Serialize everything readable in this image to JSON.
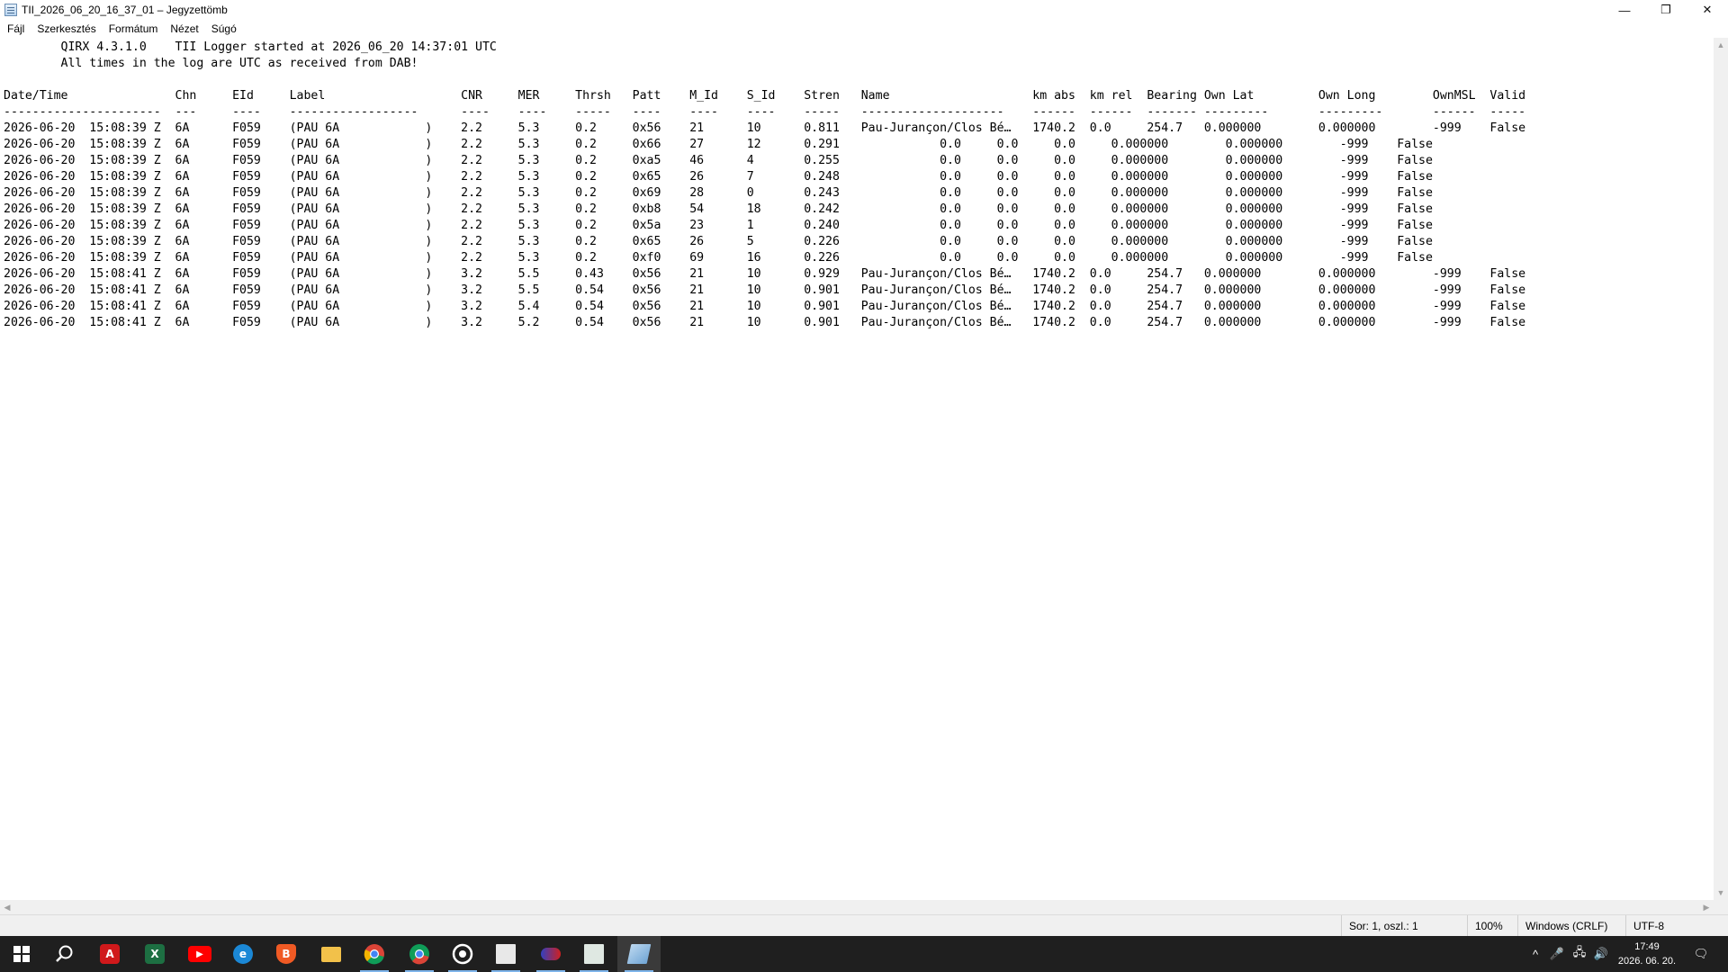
{
  "window": {
    "title": "TII_2026_06_20_16_37_01 – Jegyzettömb",
    "minimize": "—",
    "restore": "❐",
    "close": "✕"
  },
  "menu": [
    "Fájl",
    "Szerkesztés",
    "Formátum",
    "Nézet",
    "Súgó"
  ],
  "document": {
    "header_lines": [
      "        QIRX 4.3.1.0    TII Logger started at 2026_06_20 14:37:01 UTC",
      "        All times in the log are UTC as received from DAB!"
    ],
    "column_header": "Date/Time               Chn     EId     Label                   CNR     MER     Thrsh   Patt    M_Id    S_Id    Stren   Name                    km abs  km rel  Bearing Own Lat         Own Long        OwnMSL  Valid",
    "separator": "----------------------  ---     ----    ------------------      ----    ----    -----   ----    ----    ----    -----   --------------------    ------  ------  ------- ---------       ---------       ------  -----",
    "rows": [
      "2026-06-20  15:08:39 Z  6A      F059    (PAU 6A            )    2.2     5.3     0.2     0x56    21      10      0.811   Pau-Jurançon/Clos Bé…   1740.2  0.0     254.7   0.000000        0.000000        -999    False",
      "2026-06-20  15:08:39 Z  6A      F059    (PAU 6A            )    2.2     5.3     0.2     0x66    27      12      0.291              0.0     0.0     0.0     0.000000        0.000000        -999    False",
      "2026-06-20  15:08:39 Z  6A      F059    (PAU 6A            )    2.2     5.3     0.2     0xa5    46      4       0.255              0.0     0.0     0.0     0.000000        0.000000        -999    False",
      "2026-06-20  15:08:39 Z  6A      F059    (PAU 6A            )    2.2     5.3     0.2     0x65    26      7       0.248              0.0     0.0     0.0     0.000000        0.000000        -999    False",
      "2026-06-20  15:08:39 Z  6A      F059    (PAU 6A            )    2.2     5.3     0.2     0x69    28      0       0.243              0.0     0.0     0.0     0.000000        0.000000        -999    False",
      "2026-06-20  15:08:39 Z  6A      F059    (PAU 6A            )    2.2     5.3     0.2     0xb8    54      18      0.242              0.0     0.0     0.0     0.000000        0.000000        -999    False",
      "2026-06-20  15:08:39 Z  6A      F059    (PAU 6A            )    2.2     5.3     0.2     0x5a    23      1       0.240              0.0     0.0     0.0     0.000000        0.000000        -999    False",
      "2026-06-20  15:08:39 Z  6A      F059    (PAU 6A            )    2.2     5.3     0.2     0x65    26      5       0.226              0.0     0.0     0.0     0.000000        0.000000        -999    False",
      "2026-06-20  15:08:39 Z  6A      F059    (PAU 6A            )    2.2     5.3     0.2     0xf0    69      16      0.226              0.0     0.0     0.0     0.000000        0.000000        -999    False",
      "2026-06-20  15:08:41 Z  6A      F059    (PAU 6A            )    3.2     5.5     0.43    0x56    21      10      0.929   Pau-Jurançon/Clos Bé…   1740.2  0.0     254.7   0.000000        0.000000        -999    False",
      "2026-06-20  15:08:41 Z  6A      F059    (PAU 6A            )    3.2     5.5     0.54    0x56    21      10      0.901   Pau-Jurançon/Clos Bé…   1740.2  0.0     254.7   0.000000        0.000000        -999    False",
      "2026-06-20  15:08:41 Z  6A      F059    (PAU 6A            )    3.2     5.4     0.54    0x56    21      10      0.901   Pau-Jurançon/Clos Bé…   1740.2  0.0     254.7   0.000000        0.000000        -999    False",
      "2026-06-20  15:08:41 Z  6A      F059    (PAU 6A            )    3.2     5.2     0.54    0x56    21      10      0.901   Pau-Jurançon/Clos Bé…   1740.2  0.0     254.7   0.000000        0.000000        -999    False"
    ]
  },
  "status": {
    "position": "Sor: 1, oszl.: 1",
    "zoom": "100%",
    "line_ending": "Windows (CRLF)",
    "encoding": "UTF-8"
  },
  "taskbar": {
    "apps": [
      {
        "icon": "search-icon",
        "label": ""
      },
      {
        "icon": "acrobat-icon",
        "label": "A"
      },
      {
        "icon": "excel-icon",
        "label": "X"
      },
      {
        "icon": "youtube-icon",
        "label": "▶"
      },
      {
        "icon": "edge-icon",
        "label": "e"
      },
      {
        "icon": "brave-icon",
        "label": "B"
      },
      {
        "icon": "file-explorer-icon",
        "label": ""
      },
      {
        "icon": "chrome-icon",
        "label": ""
      },
      {
        "icon": "chrome-alt-icon",
        "label": ""
      },
      {
        "icon": "app-icon",
        "label": ""
      },
      {
        "icon": "sdr-app-icon",
        "label": ""
      },
      {
        "icon": "dab-app-icon",
        "label": ""
      },
      {
        "icon": "sheet-app-icon",
        "label": ""
      },
      {
        "icon": "notepad-icon",
        "label": ""
      }
    ],
    "time": "17:49",
    "date": "2026. 06. 20."
  }
}
